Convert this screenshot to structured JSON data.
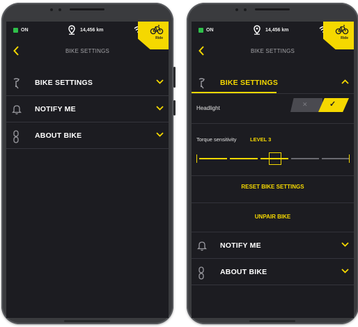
{
  "status": {
    "power": "ON",
    "distance": "14,456 km",
    "corner_label": "Ride"
  },
  "topbar": {
    "title": "BIKE SETTINGS"
  },
  "left": {
    "rows": [
      {
        "label": "BIKE SETTINGS",
        "icon": "bike-seat-icon"
      },
      {
        "label": "NOTIFY ME",
        "icon": "bell-icon"
      },
      {
        "label": "ABOUT BIKE",
        "icon": "bike-chain-icon"
      }
    ]
  },
  "right": {
    "section_title": "BIKE SETTINGS",
    "headlight": {
      "label": "Headlight",
      "off_symbol": "✕",
      "on_symbol": "✓",
      "state": "on"
    },
    "torque": {
      "label": "Torque sensitivity",
      "level": "LEVEL 3",
      "value": 3,
      "max": 5
    },
    "reset_label": "RESET BIKE SETTINGS",
    "unpair_label": "UNPAIR BIKE",
    "rows": [
      {
        "label": "NOTIFY ME",
        "icon": "bell-icon"
      },
      {
        "label": "ABOUT BIKE",
        "icon": "bike-chain-icon"
      }
    ]
  },
  "colors": {
    "accent": "#f5d800",
    "screen_bg": "#1c1c21",
    "status_on": "#2fbf4a"
  }
}
